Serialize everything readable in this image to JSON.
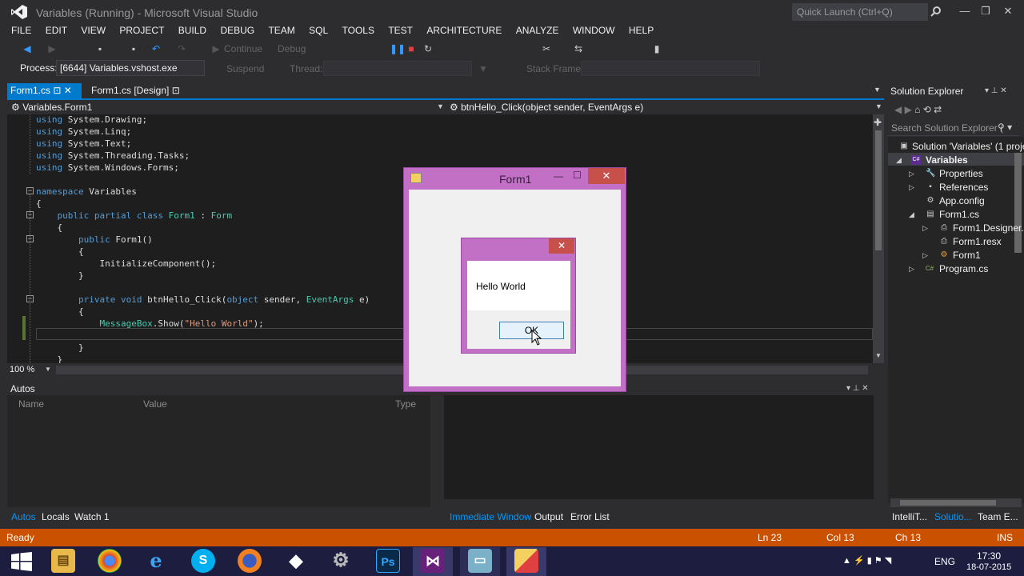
{
  "window": {
    "title": "Variables (Running) - Microsoft Visual Studio",
    "quick_launch": "Quick Launch (Ctrl+Q)"
  },
  "menu": [
    "FILE",
    "EDIT",
    "VIEW",
    "PROJECT",
    "BUILD",
    "DEBUG",
    "TEAM",
    "SQL",
    "TOOLS",
    "TEST",
    "ARCHITECTURE",
    "ANALYZE",
    "WINDOW",
    "HELP"
  ],
  "toolbar": {
    "continue_label": "Continue",
    "config": "Debug",
    "process_label": "Process:",
    "process_value": "[6644] Variables.vshost.exe",
    "suspend_label": "Suspend",
    "thread_label": "Thread:",
    "stack_frame_label": "Stack Frame:"
  },
  "tabs": {
    "active": "Form1.cs",
    "design": "Form1.cs [Design]"
  },
  "nav": {
    "class_dropdown": "Variables.Form1",
    "member_dropdown": "btnHello_Click(object sender, EventArgs e)"
  },
  "editor": {
    "zoom": "100 %"
  },
  "autos": {
    "title": "Autos",
    "columns": [
      "Name",
      "Value",
      "Type"
    ]
  },
  "bottom_tabs_left": [
    "Autos",
    "Locals",
    "Watch 1"
  ],
  "bottom_tabs_right": [
    "Immediate Window",
    "Output",
    "Error List"
  ],
  "solution_explorer": {
    "title": "Solution Explorer",
    "search_placeholder": "Search Solution Explorer (",
    "items": [
      "Solution 'Variables' (1 proje",
      "Variables",
      "Properties",
      "References",
      "App.config",
      "Form1.cs",
      "Form1.Designer.",
      "Form1.resx",
      "Form1",
      "Program.cs"
    ],
    "bottom_tabs": [
      "IntelliT...",
      "Solutio...",
      "Team E..."
    ]
  },
  "status": {
    "state": "Ready",
    "line": "Ln 23",
    "col": "Col 13",
    "ch": "Ch 13",
    "mode": "INS"
  },
  "form1": {
    "title": "Form1"
  },
  "messagebox": {
    "text": "Hello World",
    "ok_label": "OK"
  },
  "taskbar": {
    "lang": "ENG",
    "time": "17:30",
    "date": "18-07-2015"
  },
  "colors": {
    "accent": "#007acc",
    "status_bar": "#ca5100",
    "dialog_border": "#c26fc6",
    "close_red": "#c7504b"
  }
}
